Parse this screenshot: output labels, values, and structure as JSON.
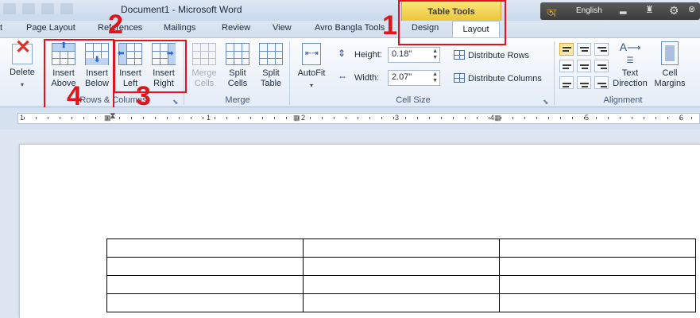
{
  "title_bar": {
    "document_title": "Document1  -  Microsoft Word",
    "contextual_tab_group": "Table Tools",
    "language": "English"
  },
  "tabs": [
    {
      "label": "t"
    },
    {
      "label": "Page Layout"
    },
    {
      "label": "References"
    },
    {
      "label": "Mailings"
    },
    {
      "label": "Review"
    },
    {
      "label": "View"
    },
    {
      "label": "Avro Bangla Tools"
    },
    {
      "label": "Design"
    },
    {
      "label": "Layout"
    }
  ],
  "ribbon": {
    "delete": {
      "label": "Delete"
    },
    "insert_above": {
      "line1": "Insert",
      "line2": "Above"
    },
    "insert_below": {
      "line1": "Insert",
      "line2": "Below"
    },
    "insert_left": {
      "line1": "Insert",
      "line2": "Left"
    },
    "insert_right": {
      "line1": "Insert",
      "line2": "Right"
    },
    "rows_columns_label": "Rows & Columns",
    "merge_cells": {
      "line1": "Merge",
      "line2": "Cells"
    },
    "split_cells": {
      "line1": "Split",
      "line2": "Cells"
    },
    "split_table": {
      "line1": "Split",
      "line2": "Table"
    },
    "merge_label": "Merge",
    "autofit": {
      "label": "AutoFit"
    },
    "height": {
      "label": "Height:",
      "value": "0.18\""
    },
    "width": {
      "label": "Width:",
      "value": "2.07\""
    },
    "distribute_rows": "Distribute Rows",
    "distribute_columns": "Distribute Columns",
    "cell_size_label": "Cell Size",
    "text_direction": {
      "line1": "Text",
      "line2": "Direction"
    },
    "cell_margins": {
      "line1": "Cell",
      "line2": "Margins"
    },
    "alignment_label": "Alignment"
  },
  "annotations": {
    "n1": "1",
    "n2": "2",
    "n3": "3",
    "n4": "4",
    "color": "#e0141b"
  },
  "ruler": {
    "numbers": [
      "1",
      "1",
      "2",
      "3",
      "4",
      "5",
      "6"
    ]
  },
  "document": {
    "table": {
      "rows": 4,
      "columns": 3
    }
  },
  "colors": {
    "accent_tab": "#ecc63b",
    "ribbon_bg": "#e4ecf7"
  }
}
